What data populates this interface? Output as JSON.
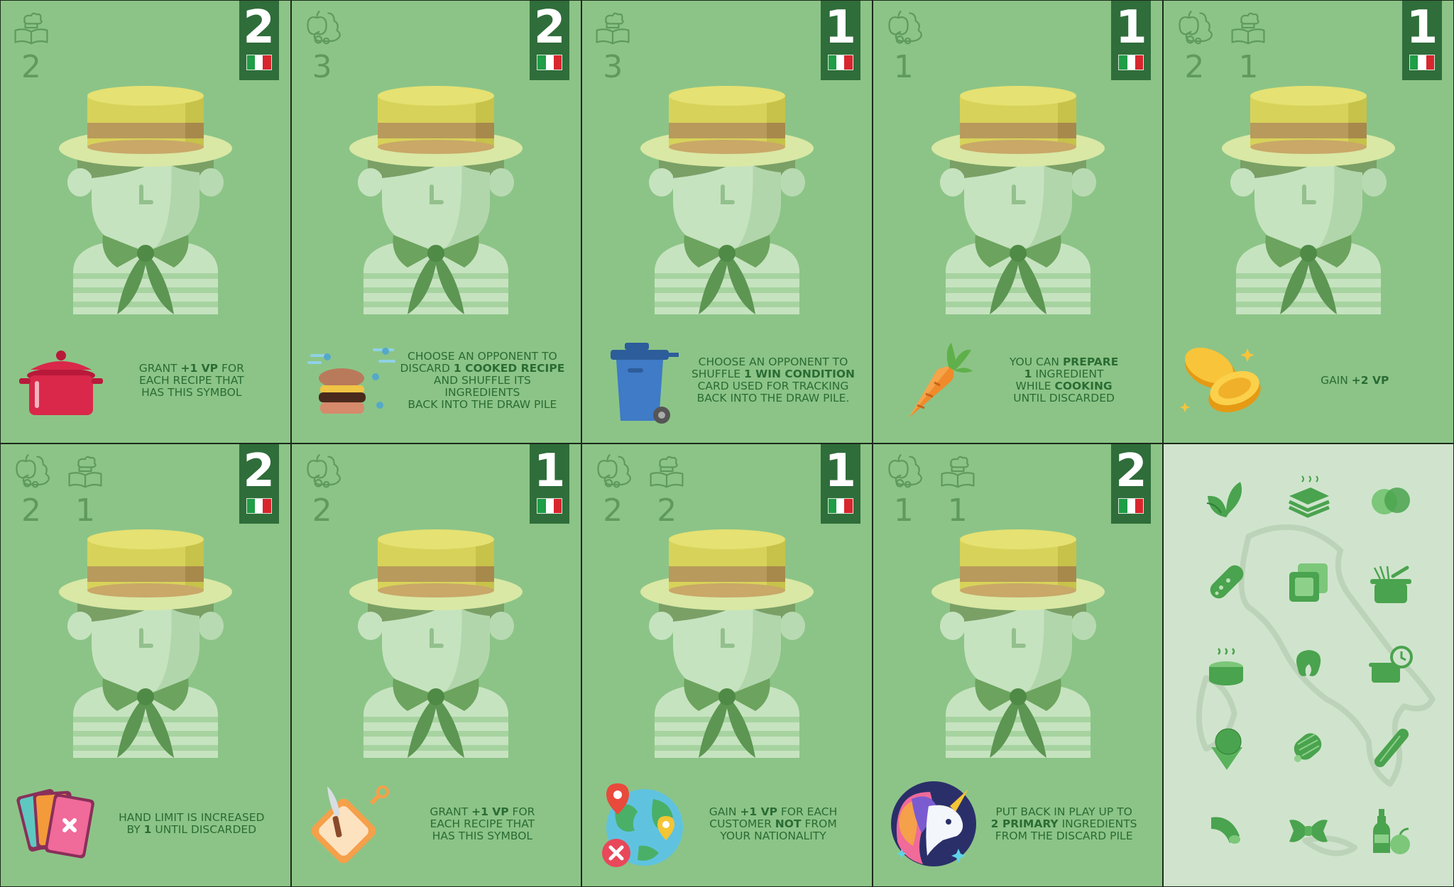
{
  "cards": [
    {
      "vp": "2",
      "costs": [
        {
          "icon": "recipe-book-icon",
          "value": "2"
        }
      ],
      "ability": {
        "icon": "red-cooking-pot-icon",
        "text": "GRANT <b>+1 VP</b> FOR\nEACH RECIPE THAT\nHAS THIS SYMBOL"
      }
    },
    {
      "vp": "2",
      "costs": [
        {
          "icon": "ingredients-icon",
          "value": "3"
        }
      ],
      "ability": {
        "icon": "flying-sandwich-icon",
        "text": "CHOOSE AN OPPONENT TO\nDISCARD <b>1 COOKED RECIPE</b>\nAND SHUFFLE ITS INGREDIENTS\nBACK INTO THE DRAW PILE"
      }
    },
    {
      "vp": "1",
      "costs": [
        {
          "icon": "recipe-book-icon",
          "value": "3"
        }
      ],
      "ability": {
        "icon": "trash-bin-icon",
        "text": "CHOOSE AN OPPONENT TO\nSHUFFLE <b>1 WIN CONDITION</b>\nCARD USED FOR TRACKING\nBACK INTO THE DRAW PILE."
      }
    },
    {
      "vp": "1",
      "costs": [
        {
          "icon": "ingredients-icon",
          "value": "1"
        }
      ],
      "ability": {
        "icon": "carrot-icon",
        "text": "YOU CAN <b>PREPARE</b>\n<b>1</b> INGREDIENT\nWHILE <b>COOKING</b>\nUNTIL DISCARDED"
      }
    },
    {
      "vp": "1",
      "costs": [
        {
          "icon": "ingredients-icon",
          "value": "2"
        },
        {
          "icon": "recipe-book-icon",
          "value": "1"
        }
      ],
      "ability": {
        "icon": "gold-coins-icon",
        "text": "GAIN <b>+2 VP</b>"
      }
    },
    {
      "vp": "2",
      "costs": [
        {
          "icon": "ingredients-icon",
          "value": "2"
        },
        {
          "icon": "recipe-book-icon",
          "value": "1"
        }
      ],
      "ability": {
        "icon": "playing-cards-icon",
        "text": "HAND LIMIT IS INCREASED\nBY <b>1</b> UNTIL DISCARDED"
      }
    },
    {
      "vp": "1",
      "costs": [
        {
          "icon": "ingredients-icon",
          "value": "2"
        }
      ],
      "ability": {
        "icon": "cutting-board-icon",
        "text": "GRANT <b>+1 VP</b> FOR\nEACH RECIPE THAT\nHAS THIS SYMBOL"
      }
    },
    {
      "vp": "1",
      "costs": [
        {
          "icon": "ingredients-icon",
          "value": "2"
        },
        {
          "icon": "recipe-book-icon",
          "value": "2"
        }
      ],
      "ability": {
        "icon": "globe-pins-icon",
        "text": "GAIN <b>+1 VP</b> FOR EACH\nCUSTOMER <b>NOT</b> FROM\nYOUR NATIONALITY"
      }
    },
    {
      "vp": "2",
      "costs": [
        {
          "icon": "ingredients-icon",
          "value": "1"
        },
        {
          "icon": "recipe-book-icon",
          "value": "1"
        }
      ],
      "ability": {
        "icon": "unicorn-icon",
        "text": "PUT BACK IN PLAY UP TO\n<b>2 PRIMARY</b> INGREDIENTS\nFROM THE DISCARD PILE"
      }
    }
  ],
  "colors": {
    "card_bg": "#8cc487",
    "banner": "#2f6d3a",
    "cost_icon": "#5f9a5c",
    "ability_text": "#2a6c34",
    "legend_bg": "#d0e4cd",
    "legend_icon": "#4aa34e"
  },
  "flag_colors": [
    "#1f9d47",
    "#ffffff",
    "#d8262e"
  ],
  "legend_icons": [
    "basil-icon",
    "lasagna-icon",
    "mozzarella-icon",
    "salami-icon",
    "ravioli-icon",
    "pot-with-pasta-icon",
    "hot-dough-icon",
    "tortellini-icon",
    "timed-pot-icon",
    "gelato-cone-icon",
    "cannoli-icon",
    "cucumber-icon",
    "macaroni-icon",
    "farfalle-icon",
    "oil-bottle-and-lime-icon"
  ]
}
